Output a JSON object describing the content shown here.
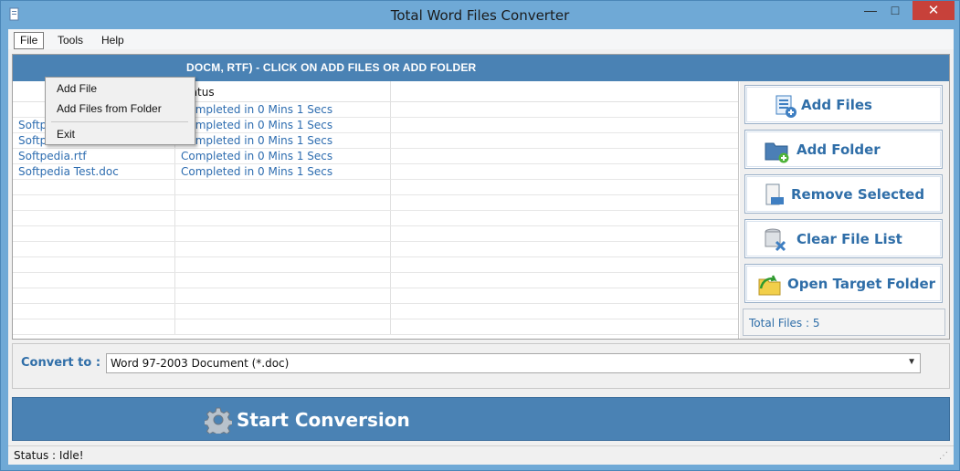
{
  "window": {
    "title": "Total Word Files Converter",
    "minimize_glyph": "—",
    "maximize_glyph": "□",
    "close_glyph": "✕"
  },
  "menubar": {
    "items": [
      {
        "label": "File"
      },
      {
        "label": "Tools"
      },
      {
        "label": "Help"
      }
    ]
  },
  "file_menu": {
    "items": [
      {
        "label": "Add File"
      },
      {
        "label": "Add Files from Folder"
      },
      {
        "label": "Exit"
      }
    ]
  },
  "files_panel": {
    "header": "DOCM, RTF) - CLICK ON ADD FILES OR ADD FOLDER",
    "status_header": "tatus",
    "rows": [
      {
        "file": "",
        "status": "Completed in 0 Mins 1 Secs"
      },
      {
        "file": "Softpedia Test.doc",
        "status": "Completed in 0 Mins 1 Secs"
      },
      {
        "file": "Softpedia.docx",
        "status": "Completed in 0 Mins 1 Secs"
      },
      {
        "file": "Softpedia.rtf",
        "status": "Completed in 0 Mins 1 Secs"
      },
      {
        "file": "Softpedia Test.doc",
        "status": "Completed in 0 Mins 1 Secs"
      }
    ]
  },
  "side_buttons": {
    "add_files": "Add Files",
    "add_folder": "Add Folder",
    "remove_selected": "Remove Selected",
    "clear_file_list": "Clear File List",
    "open_target_folder": "Open Target Folder"
  },
  "total_files": "Total Files : 5",
  "convert": {
    "label": "Convert to :",
    "selected": "Word 97-2003 Document (*.doc)"
  },
  "start_button": "Start Conversion",
  "statusbar": {
    "text": "Status  :  Idle!"
  },
  "colors": {
    "accent": "#4a82b4",
    "link_blue": "#2e6db0",
    "close_red": "#c7413a"
  }
}
